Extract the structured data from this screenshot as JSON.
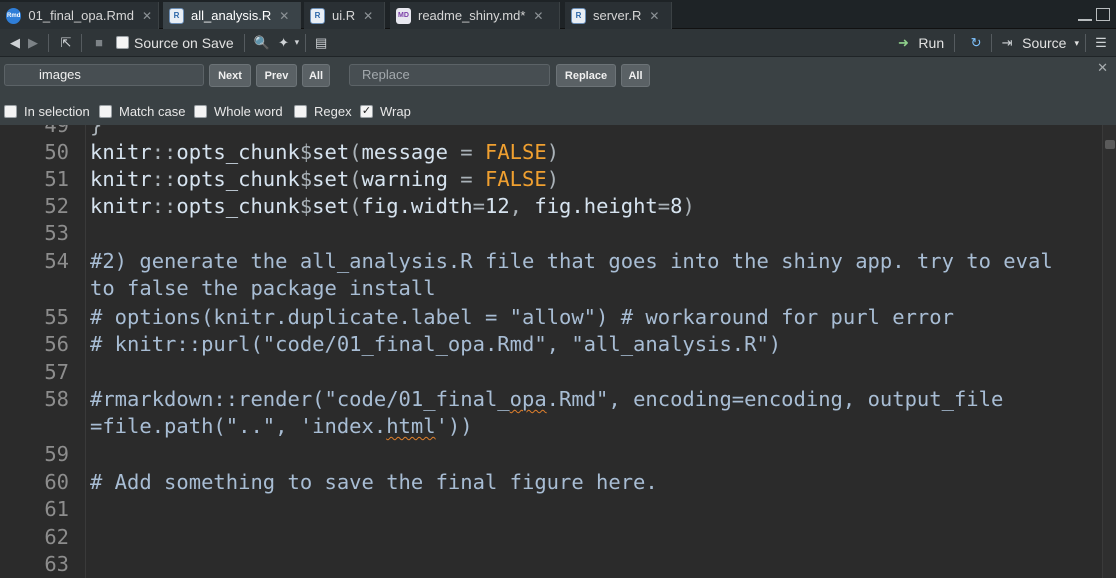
{
  "tabs": [
    {
      "name": "01_final_opa.Rmd",
      "icon": "rmd-file-icon",
      "badge": "Rmd",
      "active": false
    },
    {
      "name": "all_analysis.R",
      "icon": "r-file-icon",
      "badge": "R",
      "active": true
    },
    {
      "name": "ui.R",
      "icon": "r-file-icon",
      "badge": "R",
      "active": false
    },
    {
      "name": "readme_shiny.md*",
      "icon": "md-file-icon",
      "badge": "MD",
      "active": false
    },
    {
      "name": "server.R",
      "icon": "r-file-icon",
      "badge": "R",
      "active": false
    }
  ],
  "toolbar": {
    "source_on_save": "Source on Save",
    "run": "Run",
    "source": "Source"
  },
  "find": {
    "search_value": "images",
    "next": "Next",
    "prev": "Prev",
    "all": "All",
    "replace_placeholder": "Replace",
    "replace_button": "Replace",
    "replace_all": "All",
    "options": {
      "in_selection": {
        "label": "In selection",
        "checked": false
      },
      "match_case": {
        "label": "Match case",
        "checked": false
      },
      "whole_word": {
        "label": "Whole word",
        "checked": false
      },
      "regex": {
        "label": "Regex",
        "checked": false
      },
      "wrap": {
        "label": "Wrap",
        "checked": true
      }
    }
  },
  "editor": {
    "line_numbers": [
      "49",
      "50",
      "51",
      "52",
      "53",
      "54",
      "55",
      "56",
      "57",
      "58",
      "59",
      "60",
      "61",
      "62",
      "63"
    ],
    "lines": {
      "l49": "}",
      "l50": "knitr::opts_chunk$set(message = FALSE)",
      "l51": "knitr::opts_chunk$set(warning = FALSE)",
      "l52": "knitr::opts_chunk$set(fig.width=12, fig.height=8)",
      "l54a": "#2) generate the all_analysis.R file that goes into the shiny app. try to eval",
      "l54b": "to false the package install",
      "l55": "# options(knitr.duplicate.label = \"allow\") # workaround for purl error",
      "l56": "# knitr::purl(\"code/01_final_opa.Rmd\", \"all_analysis.R\")",
      "l58a": "#rmarkdown::render(\"code/01_final_opa.Rmd\", encoding=encoding, output_file",
      "l58b": "=file.path(\"..\", 'index.html'))",
      "l60": "# Add something to save the final figure here."
    }
  },
  "colors": {
    "keyword": "#f0a030",
    "comment": "#a8bdd4",
    "code_text": "#d6e3ef",
    "line_number": "#8d8d8d"
  }
}
